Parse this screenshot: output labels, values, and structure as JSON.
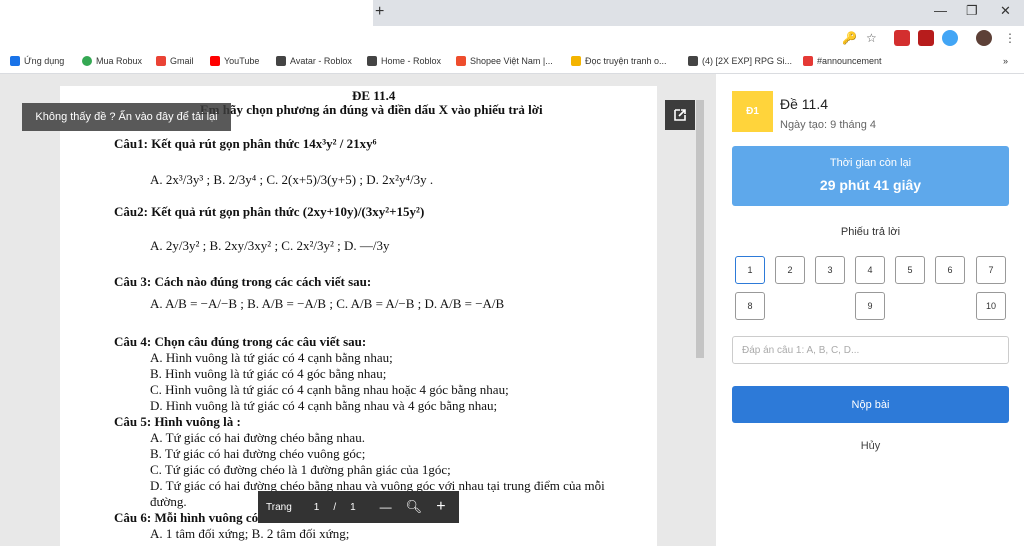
{
  "browser": {
    "new_tab": "+",
    "win_min": "—",
    "win_max": "❐",
    "win_close": "✕",
    "bookmarks": [
      {
        "label": "Ứng dụng",
        "color": "#1a73e8"
      },
      {
        "label": "Mua Robux",
        "color": "#34a853"
      },
      {
        "label": "Gmail",
        "color": "#ea4335"
      },
      {
        "label": "YouTube",
        "color": "#ff0000"
      },
      {
        "label": "Avatar - Roblox",
        "color": "#444444"
      },
      {
        "label": "Home - Roblox",
        "color": "#444444"
      },
      {
        "label": "Shopee Việt Nam |...",
        "color": "#ee4d2d"
      },
      {
        "label": "Đọc truyện tranh o...",
        "color": "#f4b400"
      },
      {
        "label": "(4) [2X EXP] RPG Si...",
        "color": "#444444"
      },
      {
        "label": "#announcement",
        "color": "#e53935"
      }
    ],
    "more": "»"
  },
  "pdf": {
    "lines": [
      {
        "text": "ĐE 11.4",
        "style": "b"
      },
      {
        "text": "Em hãy chọn phương án đúng và điền dấu X vào phiếu trả lời",
        "style": "b"
      },
      {
        "text": "Câu1: Kết quả rút gọn phân thức  14x³y² / 21xy⁶",
        "style": "b"
      },
      {
        "text": "A.  2x³/3y³ ;          B.  2/3y⁴ ;          C.  2(x+5)/3(y+5) ;       D.  2x²y⁴/3y .",
        "style": ""
      },
      {
        "text": "Câu2: Kết quả rút gọn phân thức  (2xy+10y)/(3xy²+15y²)",
        "style": "b"
      },
      {
        "text": "A.  2y/3y² ;          B.  2xy/3xy² ;          C.  2x²/3y² ;          D.  —/3y",
        "style": ""
      },
      {
        "text": "Câu 3: Cách nào đúng trong các cách viết sau:",
        "style": "b"
      },
      {
        "text": "A.  A/B = −A/−B  ;   B.  A/B = −A/B   ; C.  A/B = A/−B   ;   D.  A/B = −A/B",
        "style": ""
      },
      {
        "text": "Câu 4: Chọn câu đúng trong các câu viết sau:",
        "style": "b"
      },
      {
        "text": "A. Hình vuông là tứ giác có 4 cạnh bằng nhau;",
        "style": ""
      },
      {
        "text": "B. Hình vuông là tứ giác có 4 góc bằng nhau;",
        "style": ""
      },
      {
        "text": "C. Hình vuông là tứ giác có 4 cạnh bằng nhau hoặc 4 góc bằng nhau;",
        "style": ""
      },
      {
        "text": "D. Hình vuông là tứ giác có 4 cạnh bằng nhau và 4 góc bằng nhau;",
        "style": ""
      },
      {
        "text": "Câu 5: Hình vuông là :",
        "style": "b"
      },
      {
        "text": "A. Tứ giác có hai đường chéo bằng nhau.",
        "style": ""
      },
      {
        "text": "B.  Tứ giác có hai đường chéo vuông góc;",
        "style": ""
      },
      {
        "text": "C. Tứ giác có đường chéo là 1 đường phân giác của 1góc;",
        "style": ""
      },
      {
        "text": "D. Tứ giác có hai đường chéo bằng nhau và vuông góc với nhau tại trung điểm của mỗi",
        "style": ""
      },
      {
        "text": "đường.",
        "style": ""
      },
      {
        "text": "Câu 6: Mỗi hình vuông có",
        "style": "b"
      },
      {
        "text": "A. 1 tâm đối xứng;                                                  B. 2 tâm đối xứng;",
        "style": ""
      }
    ],
    "notice": "Không thấy đề ? Ấn vào đây để tải lại",
    "pager": {
      "label": "Trang",
      "current": "1",
      "sep": "/",
      "total": "1",
      "minus": "—",
      "plus": "+"
    }
  },
  "panel": {
    "badge": "Đ1",
    "title": "Đề 11.4",
    "date": "Ngày tạo: 9 tháng 4",
    "timer_label": "Thời gian còn lại",
    "timer_value": "29 phút 41 giây",
    "sheet_title": "Phiếu trả lời",
    "questions": [
      "1",
      "2",
      "3",
      "4",
      "5",
      "6",
      "7",
      "8",
      "9",
      "10"
    ],
    "answer_placeholder": "Đáp án câu 1: A, B, C, D...",
    "submit": "Nộp bài",
    "cancel": "Hủy"
  },
  "colors": {
    "accent": "#2d7ad8",
    "timer": "#5ea8eb",
    "badge": "#ffd43b"
  }
}
